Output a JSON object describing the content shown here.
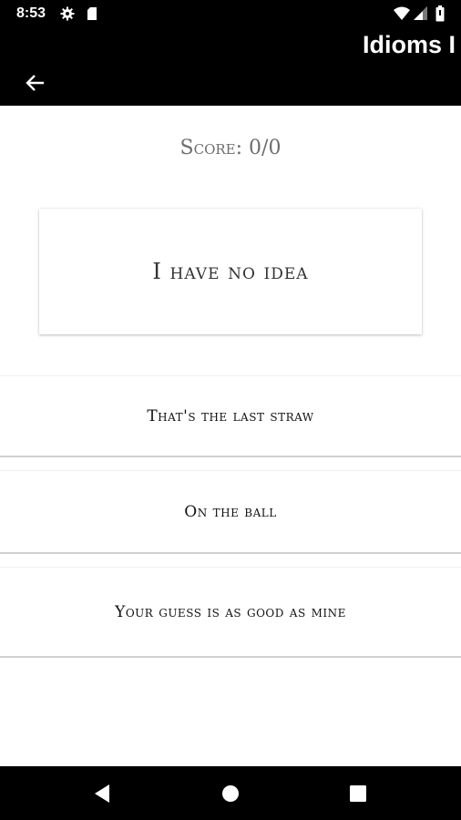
{
  "status_bar": {
    "time": "8:53",
    "icons": [
      "gear-icon",
      "sd-card-icon",
      "wifi-icon",
      "cell-signal-icon",
      "battery-icon"
    ]
  },
  "app_bar": {
    "title": "Idioms I",
    "back_icon": "arrow-left-icon"
  },
  "quiz": {
    "score_label": "Score: 0/0",
    "idiom": "I have no idea",
    "answers": [
      {
        "label": "That's the last straw"
      },
      {
        "label": "On the ball"
      },
      {
        "label": "Your guess is as good as mine"
      }
    ]
  },
  "nav_bar": {
    "icons": [
      "nav-back-icon",
      "nav-home-icon",
      "nav-recents-icon"
    ]
  },
  "colors": {
    "bar_background": "#000000",
    "page_background": "#ffffff",
    "score_text": "#6e6e6e",
    "divider": "#d0d0d0"
  }
}
